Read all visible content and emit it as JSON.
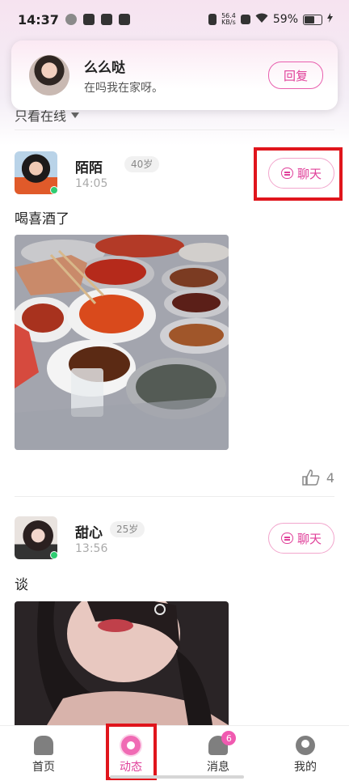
{
  "status_bar": {
    "time": "14:37",
    "network_speed": "56.4",
    "network_unit": "KB/s",
    "battery": "59%"
  },
  "notification": {
    "name": "么么哒",
    "message": "在吗我在家呀。",
    "reply_label": "回复"
  },
  "filter": {
    "label": "只看在线"
  },
  "posts": [
    {
      "name": "陌陌",
      "age": "40岁",
      "time": "14:05",
      "chat_label": "聊天",
      "text": "喝喜酒了",
      "likes": "4"
    },
    {
      "name": "甜心",
      "age": "25岁",
      "time": "13:56",
      "chat_label": "聊天",
      "text": "谈"
    }
  ],
  "tabs": [
    {
      "label": "首页",
      "icon": "home-icon"
    },
    {
      "label": "动态",
      "icon": "moments-icon",
      "active": true
    },
    {
      "label": "消息",
      "icon": "bell-icon",
      "badge": "6"
    },
    {
      "label": "我的",
      "icon": "profile-icon"
    }
  ],
  "colors": {
    "accent": "#e0409a",
    "highlight": "#e0151c",
    "online": "#2ecc71"
  }
}
